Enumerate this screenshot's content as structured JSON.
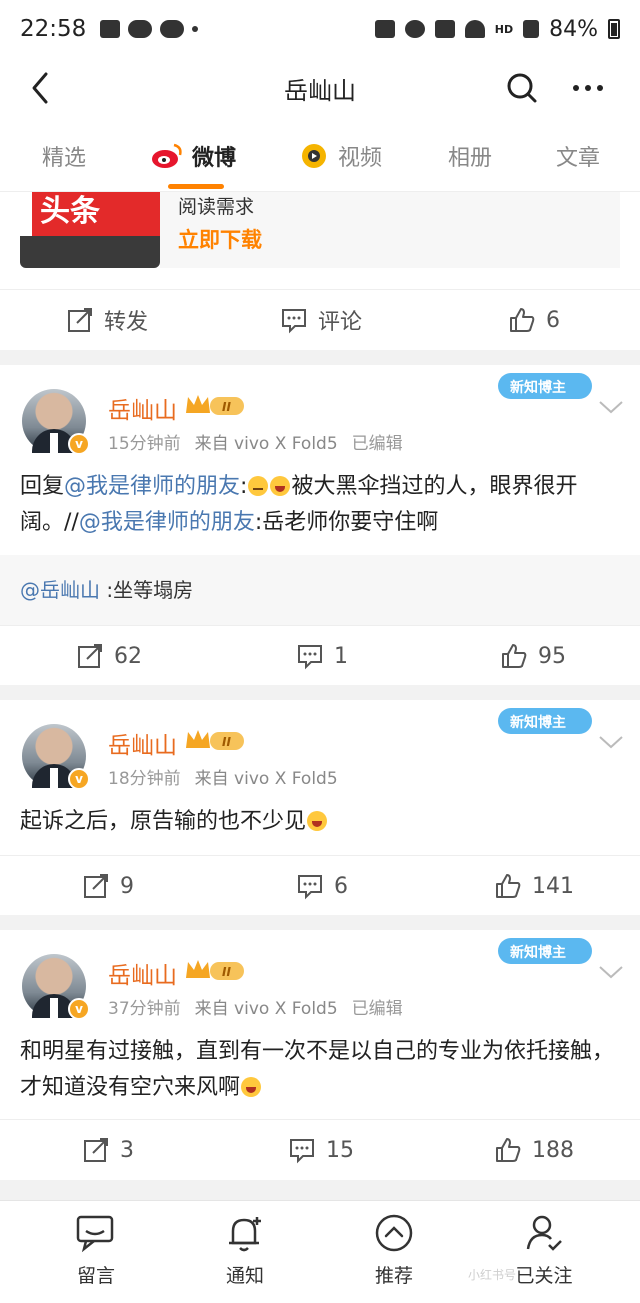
{
  "status_bar": {
    "time": "22:58",
    "network": "HD",
    "battery": "84%"
  },
  "nav": {
    "title": "岳屾山"
  },
  "tabs": [
    {
      "label": "精选"
    },
    {
      "label": "微博"
    },
    {
      "label": "视频"
    },
    {
      "label": "相册"
    },
    {
      "label": "文章"
    }
  ],
  "ad": {
    "image_text": "头条",
    "text": "阅读需求",
    "link": "立即下载"
  },
  "ad_actions": {
    "repost": "转发",
    "comment": "评论",
    "like": "6"
  },
  "posts": [
    {
      "name": "岳屾山",
      "level": "II",
      "badge": "新知博主",
      "time": "15分钟前",
      "source": "来自 vivo X Fold5",
      "edited": "已编辑",
      "reply_prefix": "回复",
      "mention1": "@我是律师的朋友",
      "text1": ":",
      "text2": "被大黑伞挡过的人，眼界很开阔。//",
      "mention2": "@我是律师的朋友",
      "text3": ":岳老师你要守住啊",
      "quote_mention": "@岳屾山",
      "quote_text": " :坐等塌房",
      "reposts": "62",
      "comments": "1",
      "likes": "95"
    },
    {
      "name": "岳屾山",
      "level": "II",
      "badge": "新知博主",
      "time": "18分钟前",
      "source": "来自 vivo X Fold5",
      "text": "起诉之后，原告输的也不少见",
      "reposts": "9",
      "comments": "6",
      "likes": "141"
    },
    {
      "name": "岳屾山",
      "level": "II",
      "badge": "新知博主",
      "time": "37分钟前",
      "source": "来自 vivo X Fold5",
      "edited": "已编辑",
      "text": "和明星有过接触，直到有一次不是以自己的专业为依托接触，才知道没有空穴来风啊",
      "reposts": "3",
      "comments": "15",
      "likes": "188"
    }
  ],
  "bottom_bar": [
    {
      "label": "留言",
      "icon": "message-icon"
    },
    {
      "label": "通知",
      "icon": "bell-plus-icon"
    },
    {
      "label": "推荐",
      "icon": "chevron-up-circle-icon"
    },
    {
      "label": "已关注",
      "icon": "user-check-icon"
    }
  ],
  "watermark": "小红书号",
  "colors": {
    "accent": "#ff8200",
    "username": "#e86b1f",
    "mention": "#4a78b0"
  }
}
